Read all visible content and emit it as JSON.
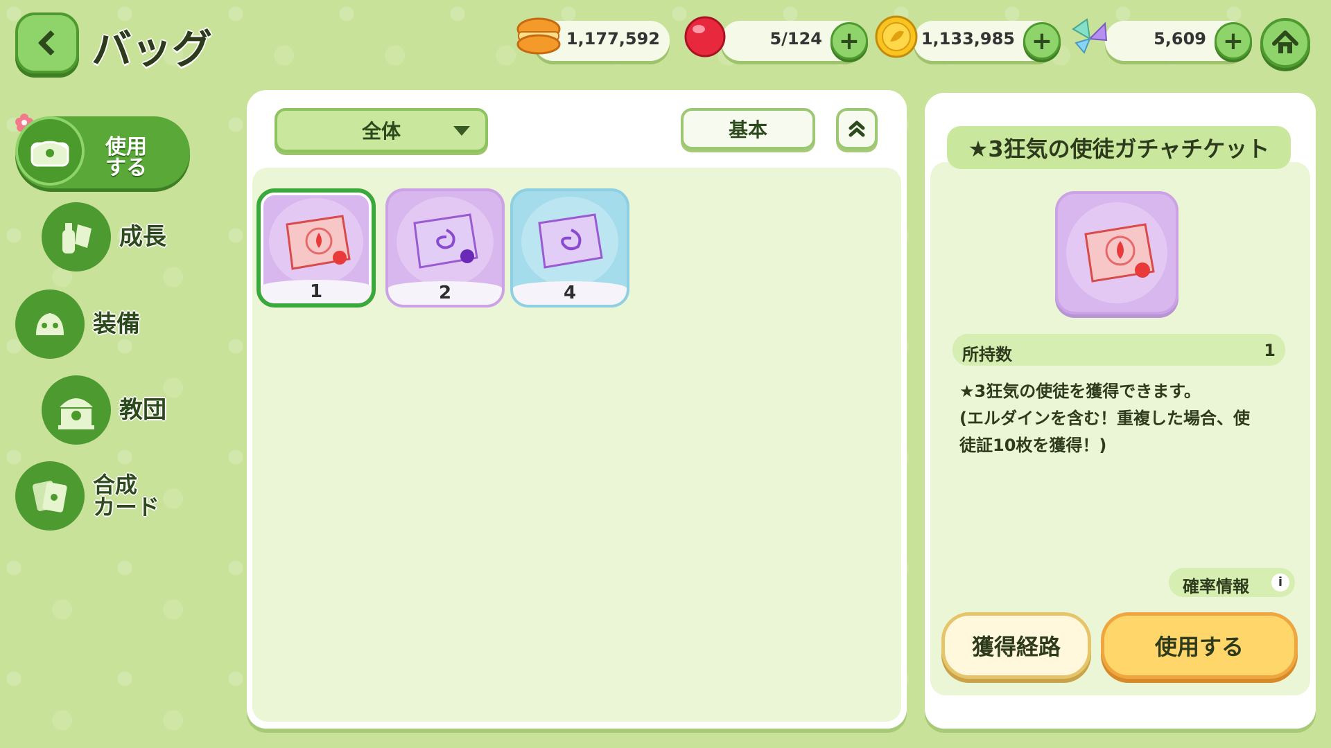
{
  "header": {
    "title": "バッグ"
  },
  "resources": [
    {
      "icon": "macaron-icon",
      "value": "1,177,592",
      "has_plus": false
    },
    {
      "icon": "candy-icon",
      "value": "5/124",
      "has_plus": true
    },
    {
      "icon": "gold-coin-icon",
      "value": "1,133,985",
      "has_plus": true
    },
    {
      "icon": "crystal-wing-icon",
      "value": "5,609",
      "has_plus": true
    }
  ],
  "sidebar": {
    "items": [
      {
        "label": "使用\nする",
        "icon": "chest-icon",
        "active": true
      },
      {
        "label": "成長",
        "icon": "potion-icon",
        "active": false
      },
      {
        "label": "装備",
        "icon": "equipment-icon",
        "active": false
      },
      {
        "label": "教団",
        "icon": "temple-icon",
        "active": false
      },
      {
        "label": "合成\nカード",
        "icon": "card-icon",
        "active": false
      }
    ]
  },
  "inventory": {
    "filter_label": "全体",
    "sort_label": "基本",
    "items": [
      {
        "icon": "red-gacha-ticket-icon",
        "count": "1",
        "bg": "purple",
        "selected": true
      },
      {
        "icon": "purple-star-ticket-icon",
        "count": "2",
        "bg": "purple",
        "selected": false
      },
      {
        "icon": "purple-swirl-ticket-icon",
        "count": "4",
        "bg": "blue",
        "selected": false
      }
    ]
  },
  "detail": {
    "title": "★3狂気の使徒ガチャチケット",
    "own_label": "所持数",
    "own_count": "1",
    "description_lines": [
      "★3狂気の使徒を獲得できます。",
      "(エルダインを含む！重複した場合、使",
      "徒証10枚を獲得！)"
    ],
    "prob_label": "確率情報",
    "route_label": "獲得経路",
    "use_label": "使用する"
  },
  "colors": {
    "background": "#c8e29a",
    "accent_green": "#4d9a30",
    "button_yellow": "#ffd66a",
    "item_purple": "#d8b6ee",
    "item_blue": "#a4dcec"
  }
}
